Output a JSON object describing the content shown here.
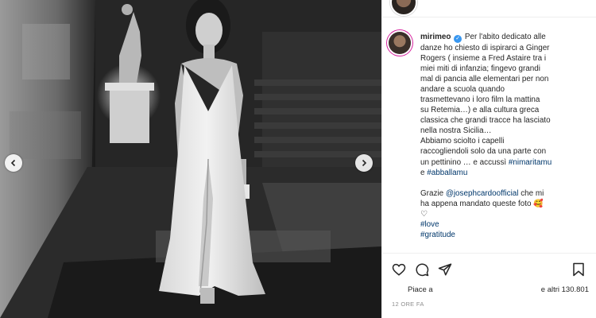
{
  "post": {
    "username": "mirimeo",
    "caption_lines": [
      "Per l'abito dedicato alle",
      "danze ho chiesto di ispirarci a Ginger",
      "Rogers ( insieme a Fred Astaire tra i",
      "miei miti di infanzia; fingevo grandi",
      "mal di pancia alle elementari per non",
      "andare a scuola quando",
      "trasmettevano i loro film la mattina",
      "su Retemia…) e alla cultura greca",
      "classica che grandi tracce ha lasciato",
      "nella nostra Sicilia…",
      "Abbiamo sciolto i capelli",
      "raccogliendoli solo da una parte con",
      "un pettinino … e accussì",
      "e"
    ],
    "hashtag_1": "#nimaritamu",
    "hashtag_2": "#abballamu",
    "thanks_prefix": "Grazie",
    "mention": "@josephcardoofficial",
    "thanks_rest_1": "che mi",
    "thanks_rest_2": "ha appena mandato queste foto",
    "hashtag_love": "#love",
    "hashtag_gratitude": "#gratitude"
  },
  "footer": {
    "likes_left": "Piace a",
    "likes_right": "e altri 130.801",
    "time_ago": "12 ORE FA"
  },
  "icons": {
    "heart": "heart-icon",
    "comment": "comment-icon",
    "share": "share-icon",
    "bookmark": "bookmark-icon",
    "verified": "verified-badge-icon"
  },
  "colors": {
    "link": "#00376b",
    "verified": "#3897f0",
    "meta": "#8e8e8e"
  }
}
